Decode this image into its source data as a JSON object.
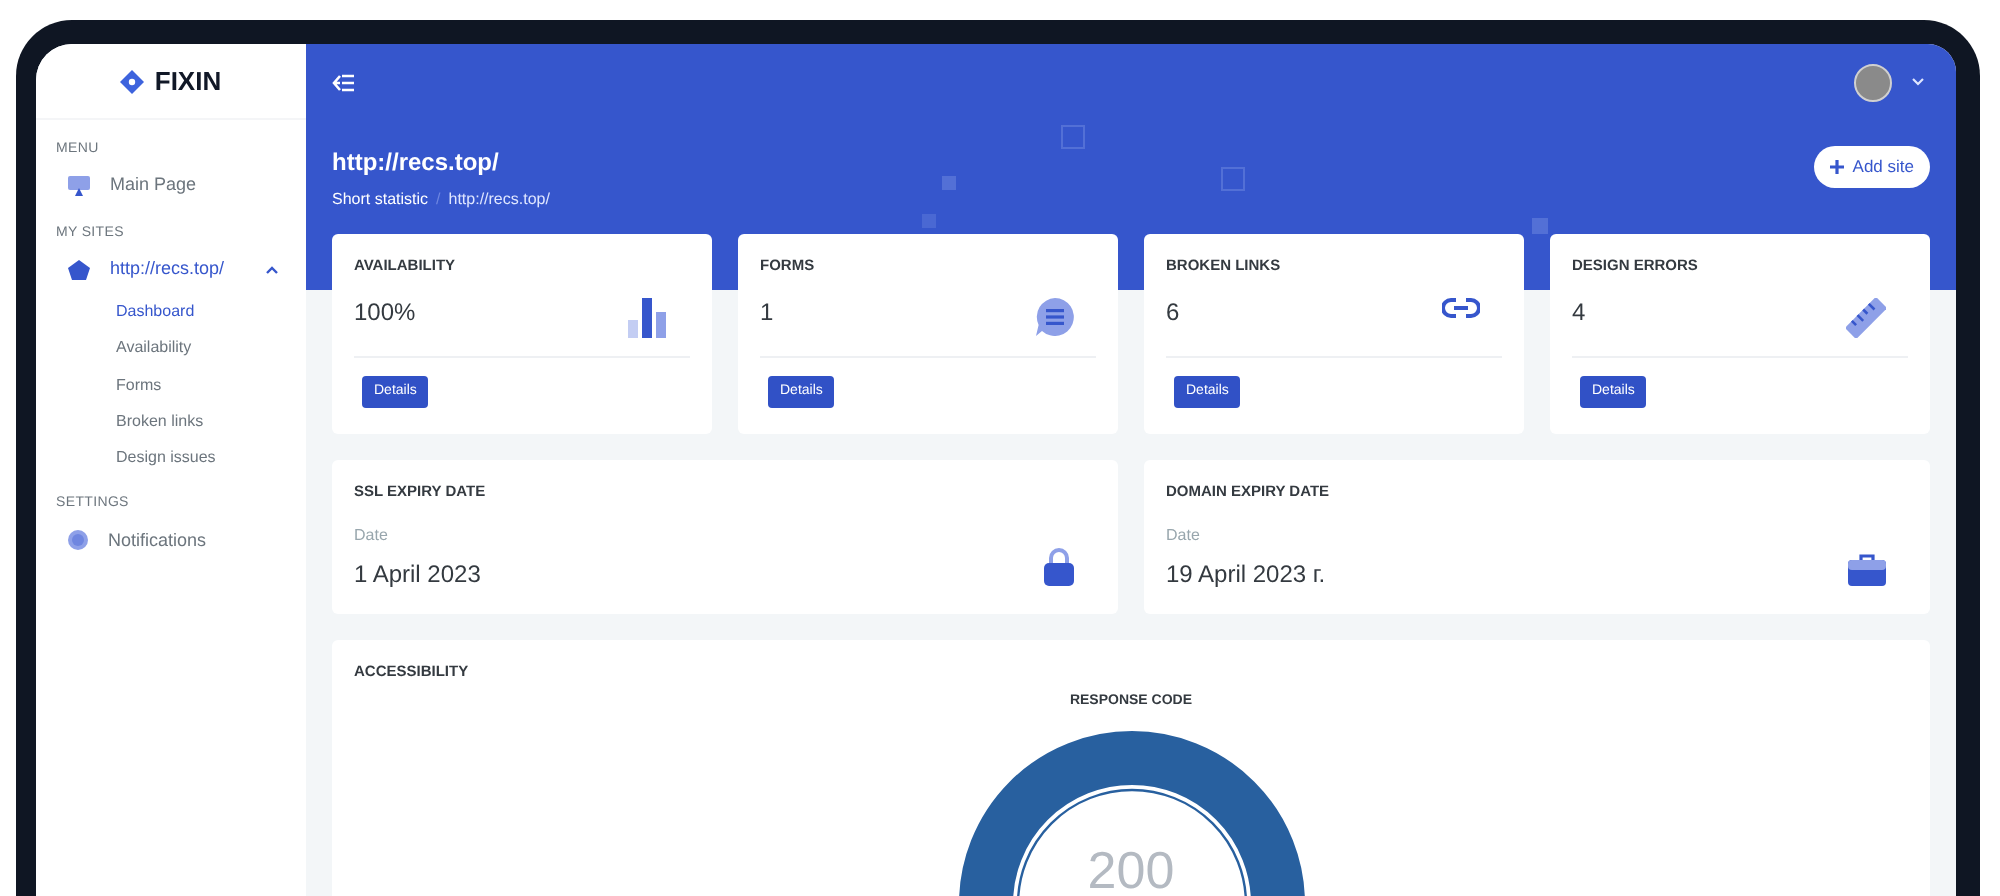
{
  "sidebar": {
    "logo": "FIXIN",
    "sections": [
      {
        "title": "MENU",
        "items": [
          {
            "label": "Main Page",
            "selected": false
          }
        ]
      },
      {
        "title": "MY SITES",
        "items": [
          {
            "label": "http://recs.top/",
            "selected": true,
            "expanded": true,
            "children": [
              {
                "label": "Dashboard",
                "selected": true
              },
              {
                "label": "Availability",
                "selected": false
              },
              {
                "label": "Forms",
                "selected": false
              },
              {
                "label": "Broken links",
                "selected": false
              },
              {
                "label": "Design issues",
                "selected": false
              }
            ]
          }
        ]
      },
      {
        "title": "SETTINGS",
        "items": [
          {
            "label": "Notifications",
            "selected": false
          }
        ]
      }
    ]
  },
  "header": {
    "title": "http://recs.top/",
    "breadcrumb": [
      "Short statistic",
      "http://recs.top/"
    ],
    "separator": "/",
    "add_button": "Add site"
  },
  "stats": [
    {
      "label": "AVAILABILITY",
      "value": "100%",
      "button": "Details"
    },
    {
      "label": "FORMS",
      "value": "1",
      "button": "Details"
    },
    {
      "label": "BROKEN LINKS",
      "value": "6",
      "button": "Details"
    },
    {
      "label": "DESIGN ERRORS",
      "value": "4",
      "button": "Details"
    }
  ],
  "dates": [
    {
      "title": "SSL EXPIRY DATE",
      "label": "Date",
      "value": "1 April 2023"
    },
    {
      "title": "DOMAIN EXPIRY DATE",
      "label": "Date",
      "value": "19 April 2023 г."
    }
  ],
  "accessibility": {
    "title": "ACCESSIBILITY",
    "gauge_title": "RESPONSE CODE",
    "gauge_value": "200"
  }
}
